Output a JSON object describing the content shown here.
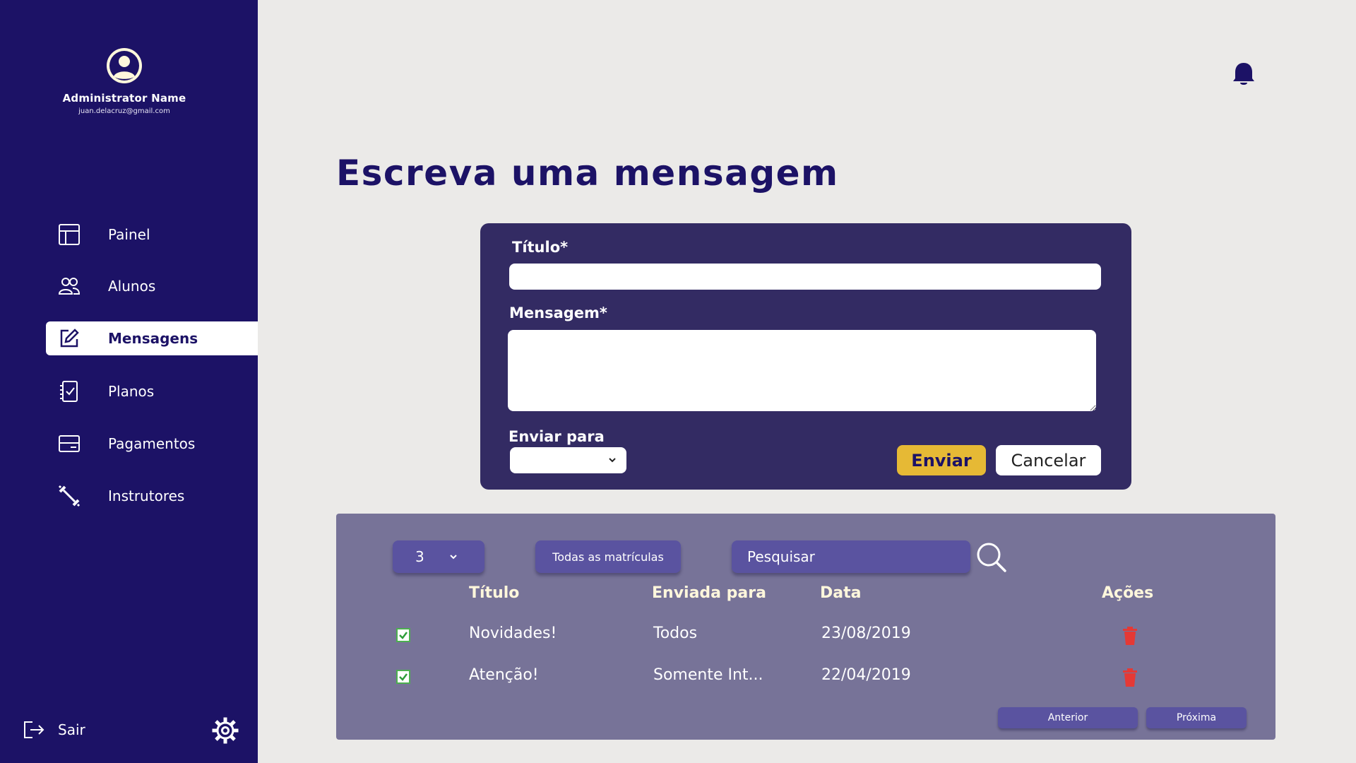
{
  "profile": {
    "name": "Administrator Name",
    "email": "juan.delacruz@gmail.com"
  },
  "sidebar": {
    "items": [
      {
        "label": "Painel",
        "icon": "layout-icon",
        "active": false
      },
      {
        "label": "Alunos",
        "icon": "users-icon",
        "active": false
      },
      {
        "label": "Mensagens",
        "icon": "edit-icon",
        "active": true
      },
      {
        "label": "Planos",
        "icon": "checklist-icon",
        "active": false
      },
      {
        "label": "Pagamentos",
        "icon": "card-icon",
        "active": false
      },
      {
        "label": "Instrutores",
        "icon": "dumbbell-icon",
        "active": false
      }
    ],
    "logout_label": "Sair"
  },
  "page": {
    "title": "Escreva uma mensagem"
  },
  "compose": {
    "title_label": "Título*",
    "title_value": "",
    "message_label": "Mensagem*",
    "message_value": "",
    "send_to_label": "Enviar para",
    "send_to_value": "",
    "send_button": "Enviar",
    "cancel_button": "Cancelar"
  },
  "list": {
    "per_page": "3",
    "filter_label": "Todas as matrículas",
    "search_placeholder": "Pesquisar",
    "headers": {
      "title": "Título",
      "sent_to": "Enviada para",
      "date": "Data",
      "actions": "Ações"
    },
    "rows": [
      {
        "checked": true,
        "title": "Novidades!",
        "sent_to": "Todos",
        "date": "23/08/2019"
      },
      {
        "checked": true,
        "title": "Atenção!",
        "sent_to": "Somente Int...",
        "date": "22/04/2019"
      }
    ],
    "prev_label": "Anterior",
    "next_label": "Próxima"
  },
  "colors": {
    "sidebar": "#1c1266",
    "compose_card": "#332b63",
    "panel": "#777398",
    "accent_yellow": "#e6b935",
    "delete_red": "#e53935",
    "checkbox_green": "#4caf50"
  }
}
